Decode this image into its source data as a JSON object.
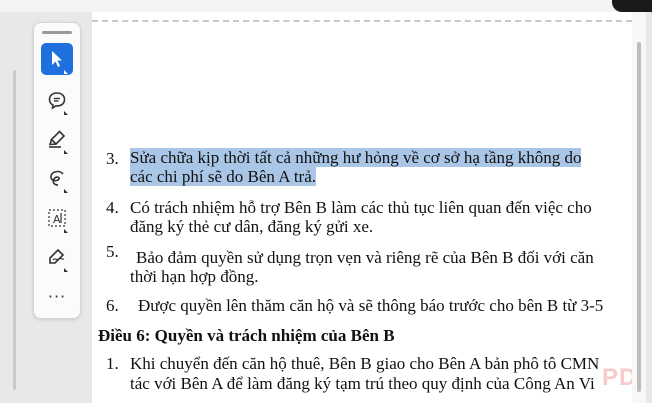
{
  "toolbar": {
    "tools": [
      {
        "name": "select",
        "icon": "arrow-cursor-icon",
        "active": true
      },
      {
        "name": "comment",
        "icon": "comment-bubble-icon",
        "active": false
      },
      {
        "name": "highlight",
        "icon": "highlighter-pen-icon",
        "active": false
      },
      {
        "name": "draw",
        "icon": "freehand-draw-icon",
        "active": false
      },
      {
        "name": "text",
        "icon": "text-box-icon",
        "active": false
      },
      {
        "name": "sign",
        "icon": "signature-pen-icon",
        "active": false
      },
      {
        "name": "more",
        "icon": "more-dots-icon",
        "label": "···"
      }
    ],
    "accent_color": "#1f6fde"
  },
  "document": {
    "items": [
      {
        "number": "3.",
        "lines": [
          "Sửa chữa kịp thời tất cả những hư hỏng về cơ sở hạ tầng không do",
          "các chi phí sẽ do Bên A trả."
        ],
        "highlighted": true
      },
      {
        "number": "4.",
        "lines": [
          "Có trách nhiệm hỗ trợ Bên B làm các thủ tục liên quan đến việc cho",
          "đăng ký thẻ cư dân, đăng ký gửi xe."
        ]
      },
      {
        "number": "5.",
        "lines": [
          "Bảo đảm quyền sử dụng trọn vẹn và riêng rẽ của Bên B đối với căn",
          "thời hạn hợp đồng."
        ]
      },
      {
        "number": "6.",
        "lines": [
          "Được quyền lên thăm căn hộ và sẽ thông báo trước cho bên B từ 3-5"
        ]
      }
    ],
    "heading": "Điều 6: Quyền và trách nhiệm của Bên B",
    "items_b": [
      {
        "number": "1.",
        "lines": [
          "Khi chuyển đến căn hộ thuê, Bên B giao cho Bên A bản phô tô CMN",
          "tác với Bên A để làm đăng ký tạm trú theo quy định của Công An Vi"
        ]
      }
    ],
    "highlight_color": "#a9c6e6"
  },
  "watermark": "PDF.VN"
}
